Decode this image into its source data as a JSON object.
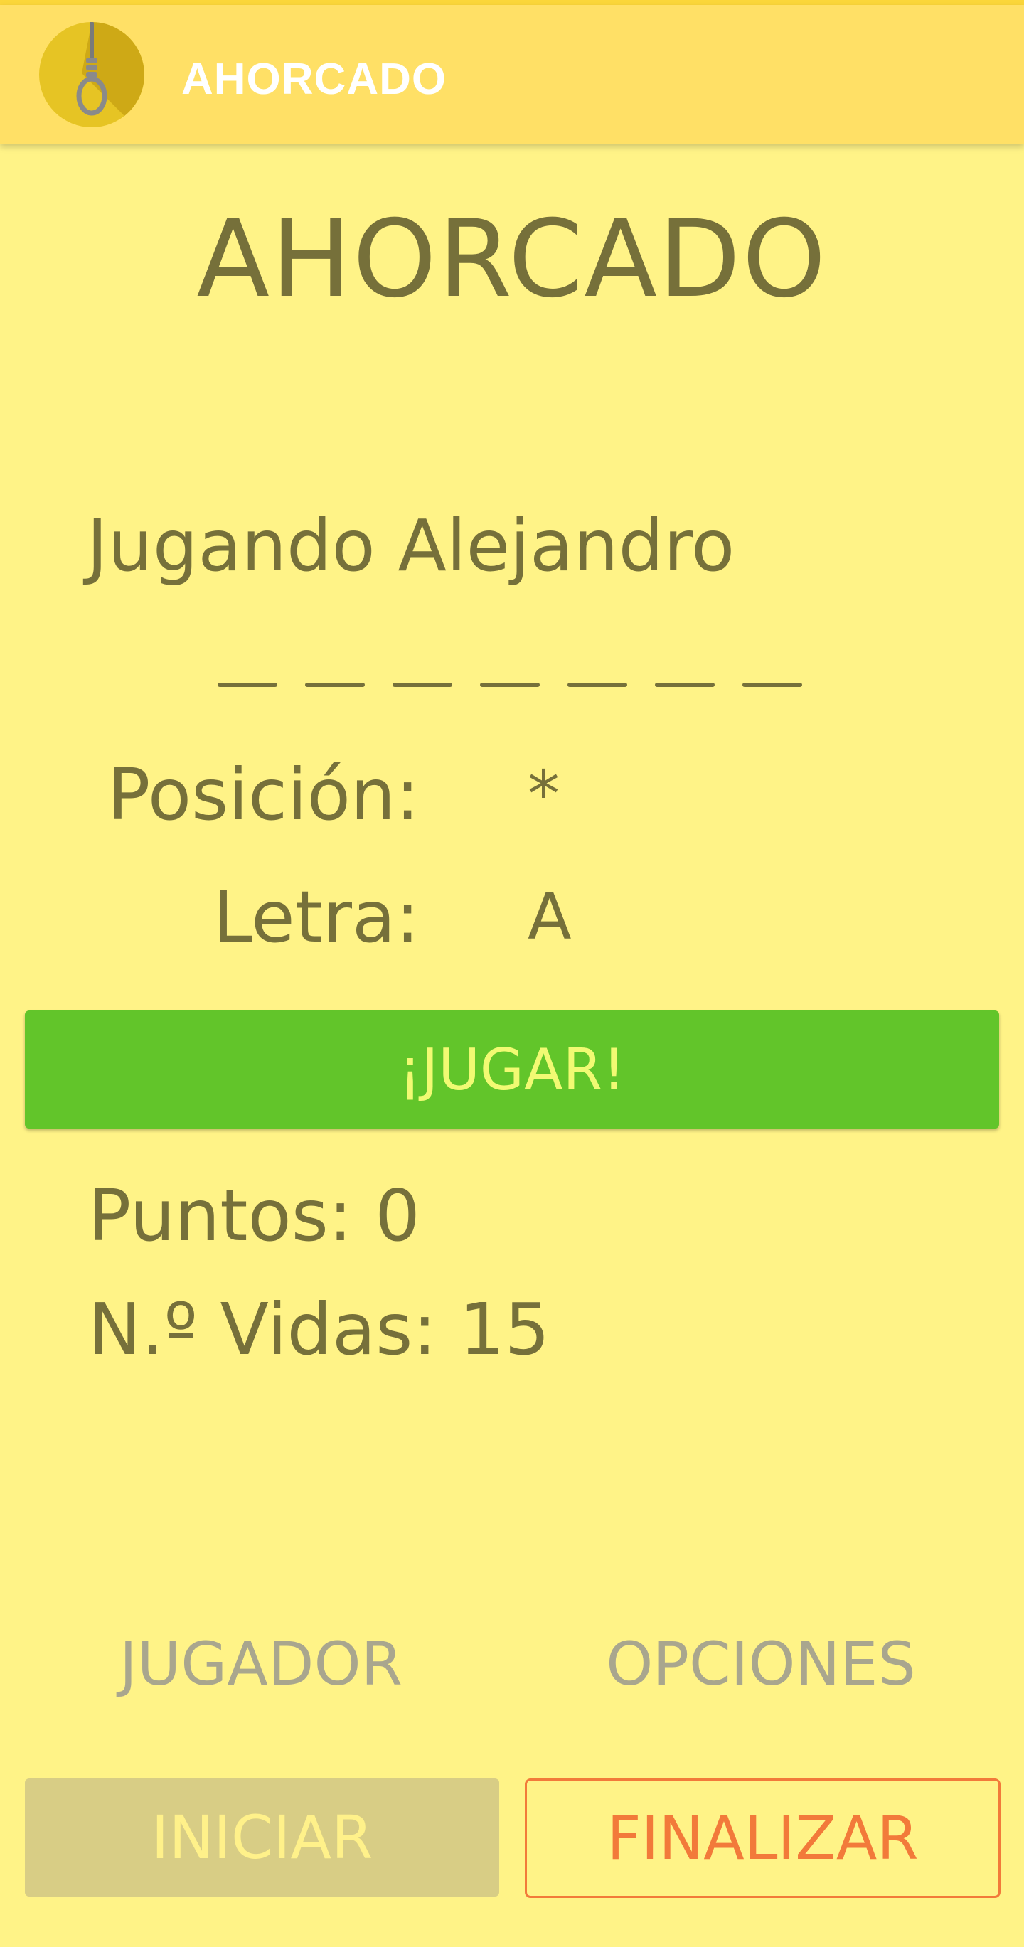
{
  "app_bar": {
    "title": "AHORCADO",
    "icon": "noose-icon"
  },
  "game": {
    "title": "AHORCADO",
    "player_label": "Jugando Alejandro",
    "word_slots": 7,
    "position_label": "Posición:",
    "position_value": "*",
    "letter_label": "Letra:",
    "letter_value": "A",
    "play_button": "¡JUGAR!",
    "points": "Puntos: 0",
    "lives": "N.º Vidas: 15"
  },
  "bottom": {
    "player_button": "JUGADOR",
    "options_button": "OPCIONES",
    "start_button": "INICIAR",
    "finish_button": "FINALIZAR"
  },
  "colors": {
    "background": "#FFF387",
    "app_bar": "#FFE066",
    "text": "#76703A",
    "play_button": "#62C52A",
    "finish_accent": "#F27A3A"
  }
}
